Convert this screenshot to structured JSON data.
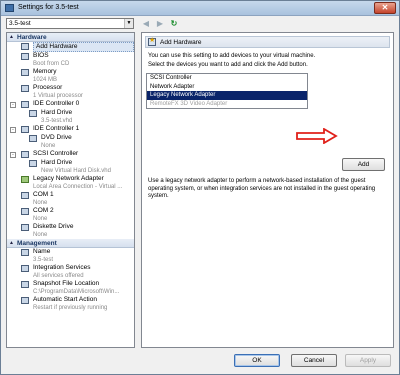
{
  "window": {
    "title": "Settings for 3.5-test"
  },
  "vm_select": {
    "value": "3.5-test"
  },
  "sidebar": {
    "hardware_header": "Hardware",
    "hardware": [
      {
        "name": "Add Hardware",
        "sub": ""
      },
      {
        "name": "BIOS",
        "sub": "Boot from CD"
      },
      {
        "name": "Memory",
        "sub": "1024 MB"
      },
      {
        "name": "Processor",
        "sub": "1 Virtual processor"
      },
      {
        "name": "IDE Controller 0",
        "sub": ""
      },
      {
        "name": "Hard Drive",
        "sub": "3.5-test.vhd"
      },
      {
        "name": "IDE Controller 1",
        "sub": ""
      },
      {
        "name": "DVD Drive",
        "sub": "None"
      },
      {
        "name": "SCSI Controller",
        "sub": ""
      },
      {
        "name": "Hard Drive",
        "sub": "New Virtual Hard Disk.vhd"
      },
      {
        "name": "Legacy Network Adapter",
        "sub": "Local Area Connection - Virtual ..."
      },
      {
        "name": "COM 1",
        "sub": "None"
      },
      {
        "name": "COM 2",
        "sub": "None"
      },
      {
        "name": "Diskette Drive",
        "sub": "None"
      }
    ],
    "management_header": "Management",
    "management": [
      {
        "name": "Name",
        "sub": "3.5-test"
      },
      {
        "name": "Integration Services",
        "sub": "All services offered"
      },
      {
        "name": "Snapshot File Location",
        "sub": "C:\\ProgramData\\Microsoft\\Win..."
      },
      {
        "name": "Automatic Start Action",
        "sub": "Restart if previously running"
      }
    ]
  },
  "panel": {
    "header": "Add Hardware",
    "intro": "You can use this setting to add devices to your virtual machine.",
    "instruction": "Select the devices you want to add and click the Add button.",
    "devices": [
      "SCSI Controller",
      "Network Adapter",
      "Legacy Network Adapter",
      "RemoteFX 3D Video Adapter"
    ],
    "selected_device": "Legacy Network Adapter",
    "add_label": "Add",
    "note": "Use a legacy network adapter to perform a network-based installation of the guest operating system, or when integration services are not installed in the guest operating system."
  },
  "footer": {
    "ok": "OK",
    "cancel": "Cancel",
    "apply": "Apply"
  },
  "colors": {
    "selection": "#0a246a",
    "arrow": "#e0201a",
    "title_bar": "#b9cfe6"
  }
}
